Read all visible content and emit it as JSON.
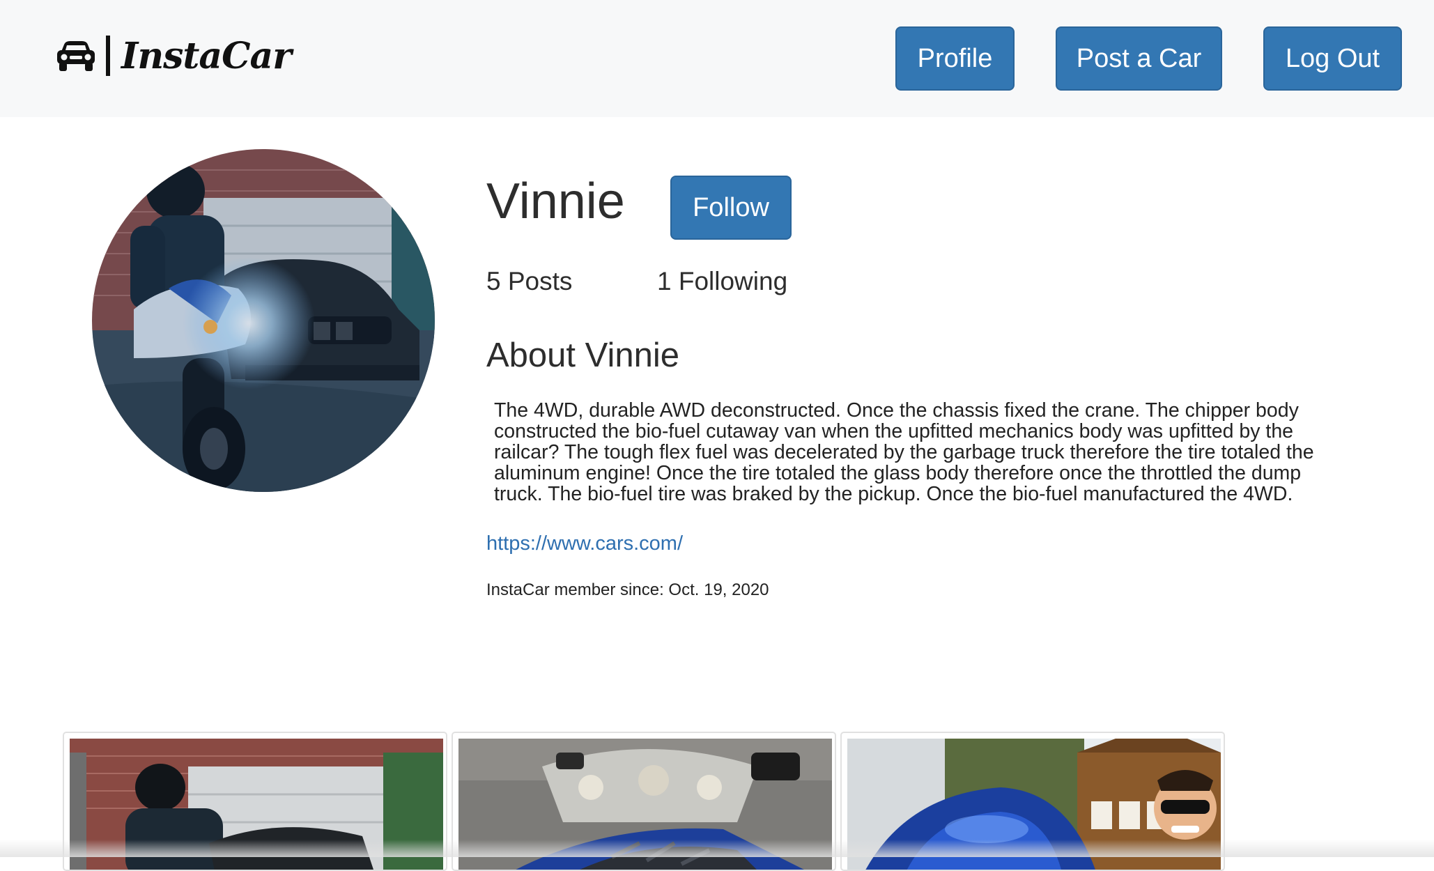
{
  "navbar": {
    "brand_name": "InstaCar",
    "brand_icon": "car-icon",
    "buttons": {
      "profile": "Profile",
      "post_car": "Post a Car",
      "logout": "Log Out"
    },
    "button_color": "#3377b3"
  },
  "profile": {
    "username": "Vinnie",
    "follow_label": "Follow",
    "posts_count": "5 Posts",
    "following_count": "1 Following",
    "about_heading": "About Vinnie",
    "bio": "The 4WD, durable AWD deconstructed. Once the chassis fixed the crane. The chipper body constructed the bio-fuel cutaway van when the upfitted mechanics body was upfitted by the railcar? The tough flex fuel was decelerated by the garbage truck therefore the tire totaled the aluminum engine! Once the tire totaled the glass body therefore once the throttled the dump truck. The bio-fuel tire was braked by the pickup. Once the bio-fuel manufactured the 4WD.",
    "website": "https://www.cars.com/",
    "member_since": "InstaCar member since: Oct. 19, 2020",
    "link_color": "#2e6fb0"
  },
  "gallery": {
    "posts": [
      {
        "name": "post-thumbnail-motorcycle-garage"
      },
      {
        "name": "post-thumbnail-motorcycle-gloves"
      },
      {
        "name": "post-thumbnail-blue-car-house"
      }
    ]
  }
}
